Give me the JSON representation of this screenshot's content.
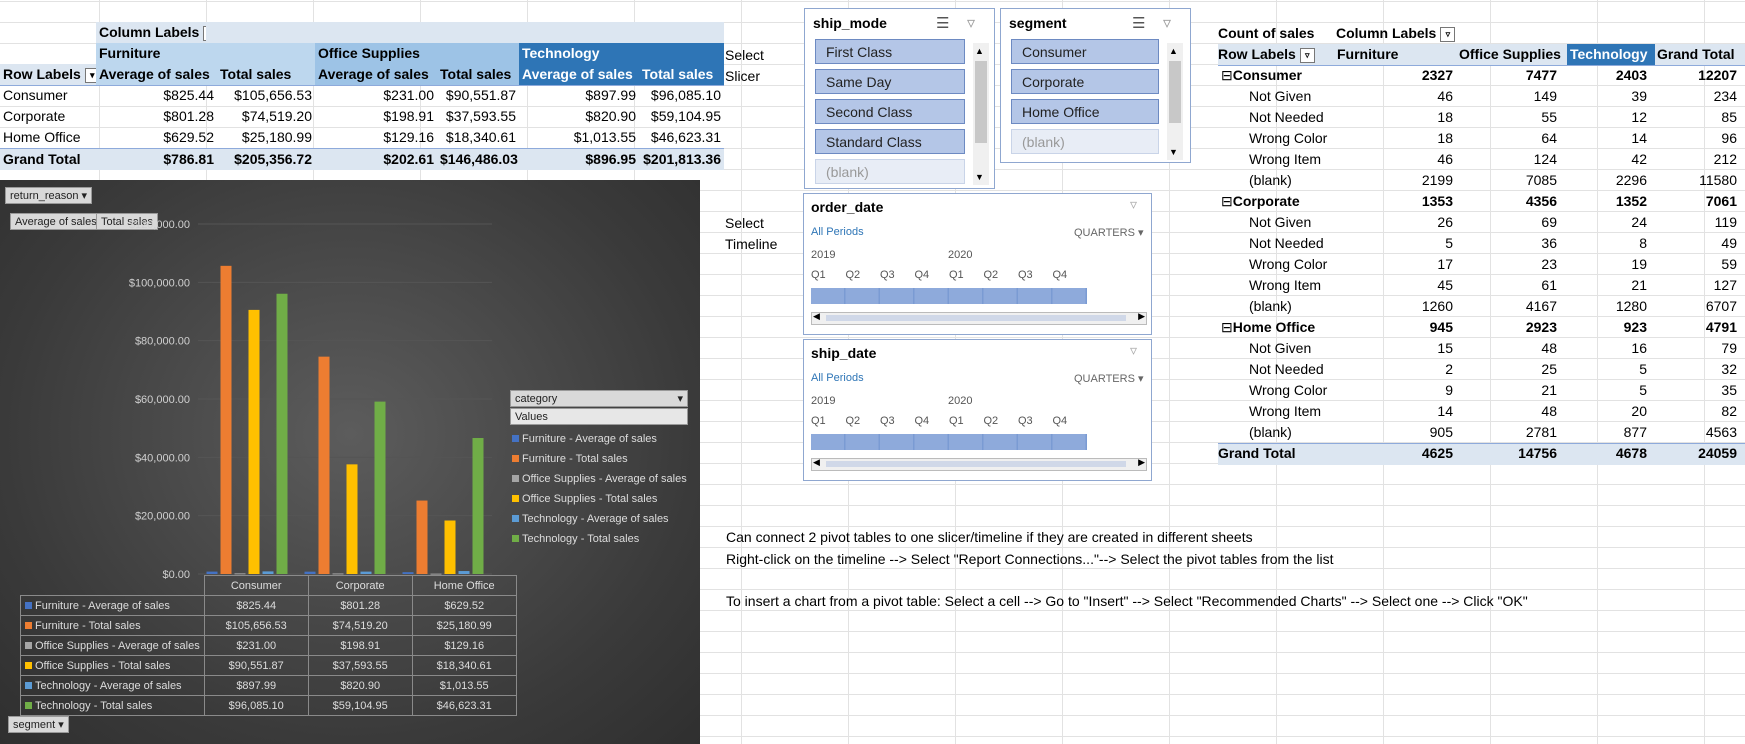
{
  "pivot1": {
    "column_labels": "Column Labels",
    "categories": [
      "Furniture",
      "Office Supplies",
      "Technology"
    ],
    "row_labels": "Row Labels",
    "sub_headers": [
      "Average of sales",
      "Total sales",
      "Average of sales",
      "Total sales",
      "Average of sales",
      "Total sales"
    ],
    "rows": [
      {
        "label": "Consumer",
        "values": [
          "$825.44",
          "$105,656.53",
          "$231.00",
          "$90,551.87",
          "$897.99",
          "$96,085.10"
        ]
      },
      {
        "label": "Corporate",
        "values": [
          "$801.28",
          "$74,519.20",
          "$198.91",
          "$37,593.55",
          "$820.90",
          "$59,104.95"
        ]
      },
      {
        "label": "Home Office",
        "values": [
          "$629.52",
          "$25,180.99",
          "$129.16",
          "$18,340.61",
          "$1,013.55",
          "$46,623.31"
        ]
      },
      {
        "label": "Grand Total",
        "values": [
          "$786.81",
          "$205,356.72",
          "$202.61",
          "$146,486.03",
          "$896.95",
          "$201,813.36"
        ]
      }
    ]
  },
  "labels": {
    "select_slicer_1": "Select",
    "select_slicer_2": "Slicer",
    "select_timeline_1": "Select",
    "select_timeline_2": "Timeline"
  },
  "chart_buttons": {
    "return_reason": "return_reason",
    "avg_sales": "Average of sales",
    "total_sales": "Total sales",
    "category": "category",
    "values": "Values",
    "segment": "segment"
  },
  "chart_data": {
    "type": "bar",
    "categories": [
      "Consumer",
      "Corporate",
      "Home Office"
    ],
    "ylim": [
      0,
      120000
    ],
    "yticks": [
      "$0.00",
      "$20,000.00",
      "$40,000.00",
      "$60,000.00",
      "$80,000.00",
      "$100,000.00",
      "$120,000.00"
    ],
    "series": [
      {
        "name": "Furniture - Average of sales",
        "color": "#4472c4",
        "values": [
          825.44,
          801.28,
          629.52
        ],
        "labels": [
          "$825.44",
          "$801.28",
          "$629.52"
        ]
      },
      {
        "name": "Furniture - Total sales",
        "color": "#ed7d31",
        "values": [
          105656.53,
          74519.2,
          25180.99
        ],
        "labels": [
          "$105,656.53",
          "$74,519.20",
          "$25,180.99"
        ]
      },
      {
        "name": "Office Supplies - Average of sales",
        "color": "#a5a5a5",
        "values": [
          231.0,
          198.91,
          129.16
        ],
        "labels": [
          "$231.00",
          "$198.91",
          "$129.16"
        ]
      },
      {
        "name": "Office Supplies - Total sales",
        "color": "#ffc000",
        "values": [
          90551.87,
          37593.55,
          18340.61
        ],
        "labels": [
          "$90,551.87",
          "$37,593.55",
          "$18,340.61"
        ]
      },
      {
        "name": "Technology - Average of sales",
        "color": "#5b9bd5",
        "values": [
          897.99,
          820.9,
          1013.55
        ],
        "labels": [
          "$897.99",
          "$820.90",
          "$1,013.55"
        ]
      },
      {
        "name": "Technology - Total sales",
        "color": "#70ad47",
        "values": [
          96085.1,
          59104.95,
          46623.31
        ],
        "labels": [
          "$96,085.10",
          "$59,104.95",
          "$46,623.31"
        ]
      }
    ]
  },
  "slicer_ship_mode": {
    "title": "ship_mode",
    "items": [
      "First Class",
      "Same Day",
      "Second Class",
      "Standard Class",
      "(blank)"
    ]
  },
  "slicer_segment": {
    "title": "segment",
    "items": [
      "Consumer",
      "Corporate",
      "Home Office",
      "(blank)"
    ]
  },
  "timeline_order": {
    "title": "order_date",
    "periods": "All Periods",
    "unit": "QUARTERS",
    "years": [
      "2019",
      "2020"
    ],
    "quarters": [
      "Q1",
      "Q2",
      "Q3",
      "Q4",
      "Q1",
      "Q2",
      "Q3",
      "Q4"
    ]
  },
  "timeline_ship": {
    "title": "ship_date",
    "periods": "All Periods",
    "unit": "QUARTERS",
    "years": [
      "2019",
      "2020"
    ],
    "quarters": [
      "Q1",
      "Q2",
      "Q3",
      "Q4",
      "Q1",
      "Q2",
      "Q3",
      "Q4"
    ]
  },
  "pivot2": {
    "corner": "Count of sales",
    "column_labels": "Column Labels",
    "row_labels": "Row Labels",
    "headers": [
      "Furniture",
      "Office Supplies",
      "Technology",
      "Grand Total"
    ],
    "rows": [
      {
        "label": "Consumer",
        "group": true,
        "values": [
          "2327",
          "7477",
          "2403",
          "12207"
        ]
      },
      {
        "label": "Not Given",
        "values": [
          "46",
          "149",
          "39",
          "234"
        ]
      },
      {
        "label": "Not Needed",
        "values": [
          "18",
          "55",
          "12",
          "85"
        ]
      },
      {
        "label": "Wrong Color",
        "values": [
          "18",
          "64",
          "14",
          "96"
        ]
      },
      {
        "label": "Wrong Item",
        "values": [
          "46",
          "124",
          "42",
          "212"
        ]
      },
      {
        "label": "(blank)",
        "values": [
          "2199",
          "7085",
          "2296",
          "11580"
        ]
      },
      {
        "label": "Corporate",
        "group": true,
        "values": [
          "1353",
          "4356",
          "1352",
          "7061"
        ]
      },
      {
        "label": "Not Given",
        "values": [
          "26",
          "69",
          "24",
          "119"
        ]
      },
      {
        "label": "Not Needed",
        "values": [
          "5",
          "36",
          "8",
          "49"
        ]
      },
      {
        "label": "Wrong Color",
        "values": [
          "17",
          "23",
          "19",
          "59"
        ]
      },
      {
        "label": "Wrong Item",
        "values": [
          "45",
          "61",
          "21",
          "127"
        ]
      },
      {
        "label": "(blank)",
        "values": [
          "1260",
          "4167",
          "1280",
          "6707"
        ]
      },
      {
        "label": "Home Office",
        "group": true,
        "values": [
          "945",
          "2923",
          "923",
          "4791"
        ]
      },
      {
        "label": "Not Given",
        "values": [
          "15",
          "48",
          "16",
          "79"
        ]
      },
      {
        "label": "Not Needed",
        "values": [
          "2",
          "25",
          "5",
          "32"
        ]
      },
      {
        "label": "Wrong Color",
        "values": [
          "9",
          "21",
          "5",
          "35"
        ]
      },
      {
        "label": "Wrong Item",
        "values": [
          "14",
          "48",
          "20",
          "82"
        ]
      },
      {
        "label": "(blank)",
        "values": [
          "905",
          "2781",
          "877",
          "4563"
        ]
      },
      {
        "label": "Grand Total",
        "total": true,
        "values": [
          "4625",
          "14756",
          "4678",
          "24059"
        ]
      }
    ]
  },
  "notes": {
    "line1": "Can connect 2 pivot tables to one slicer/timeline if they are created in different sheets",
    "line2": "Right-click on the timeline --> Select \"Report Connections...\"--> Select the pivot tables from the list",
    "line3": "To insert a chart from a pivot table: Select a cell --> Go to \"Insert\" --> Select \"Recommended Charts\" --> Select one --> Click \"OK\""
  }
}
